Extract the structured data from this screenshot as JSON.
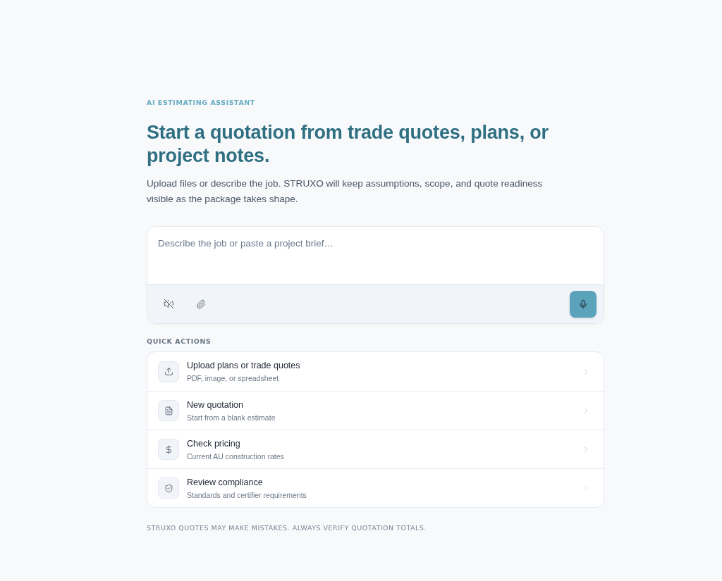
{
  "header": {
    "eyebrow": "AI ESTIMATING ASSISTANT",
    "title": "Start a quotation from trade quotes, plans, or project notes.",
    "description": "Upload files or describe the job. STRUXO will keep assumptions, scope, and quote readiness visible as the package takes shape."
  },
  "composer": {
    "placeholder": "Describe the job or paste a project brief…"
  },
  "quick_actions": {
    "label": "QUICK ACTIONS",
    "items": [
      {
        "kind": "upload",
        "title": "Upload plans or trade quotes",
        "subtitle": "PDF, image, or spreadsheet"
      },
      {
        "kind": "document",
        "title": "New quotation",
        "subtitle": "Start from a blank estimate"
      },
      {
        "kind": "pricing",
        "title": "Check pricing",
        "subtitle": "Current AU construction rates"
      },
      {
        "kind": "compliance",
        "title": "Review compliance",
        "subtitle": "Standards and certifier requirements"
      }
    ]
  },
  "footer": "STRUXO QUOTES MAY MAKE MISTAKES. ALWAYS VERIFY QUOTATION TOTALS."
}
